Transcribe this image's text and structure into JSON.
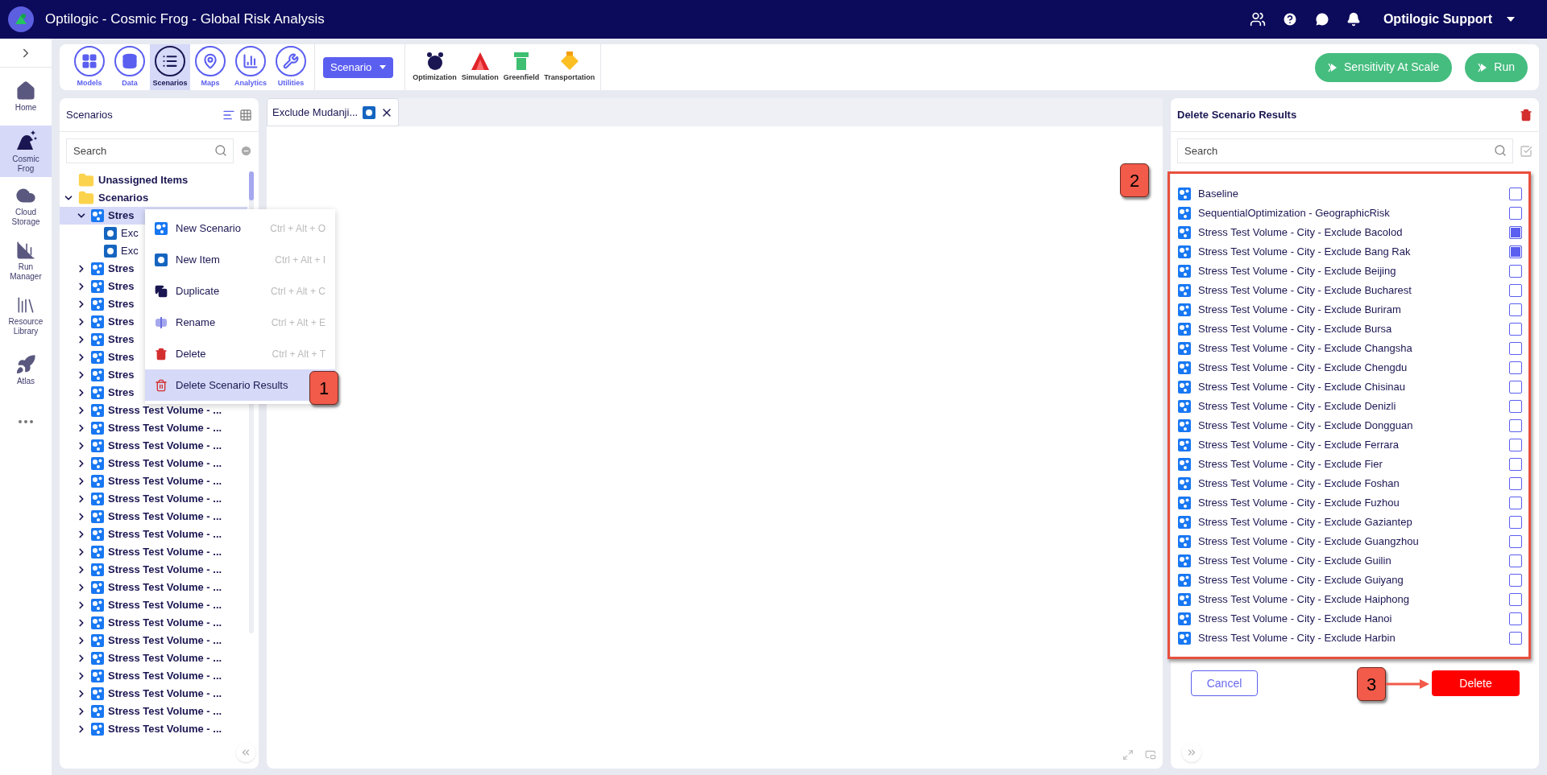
{
  "header": {
    "title": "Optilogic - Cosmic Frog - Global Risk Analysis",
    "user": "Optilogic Support"
  },
  "rail": {
    "items": [
      {
        "label": "Home",
        "selected": false
      },
      {
        "label": "Cosmic Frog",
        "selected": true
      },
      {
        "label": "Cloud Storage",
        "selected": false
      },
      {
        "label": "Run Manager",
        "selected": false
      },
      {
        "label": "Resource Library",
        "selected": false
      },
      {
        "label": "Atlas",
        "selected": false
      }
    ]
  },
  "toolbar": {
    "modules": [
      {
        "label": "Models",
        "selected": false
      },
      {
        "label": "Data",
        "selected": false
      },
      {
        "label": "Scenarios",
        "selected": true
      },
      {
        "label": "Maps",
        "selected": false
      },
      {
        "label": "Analytics",
        "selected": false
      },
      {
        "label": "Utilities",
        "selected": false
      }
    ],
    "dropdown": "Scenario",
    "engines": [
      "Optimization",
      "Simulation",
      "Greenfield",
      "Transportation"
    ],
    "actions": [
      "Sensitivity At Scale",
      "Run"
    ]
  },
  "scenarios_panel": {
    "title": "Scenarios",
    "search": {
      "placeholder": "Search"
    },
    "tree": [
      {
        "label": "Unassigned Items",
        "kind": "folder",
        "selected": false
      },
      {
        "label": "Scenarios",
        "kind": "folder",
        "expanded": true,
        "selected": false,
        "children": [
          {
            "label": "Stres",
            "kind": "scenario",
            "expanded": true,
            "selected": true,
            "children": [
              {
                "label": "Exc",
                "kind": "item",
                "selected": false
              },
              {
                "label": "Exc",
                "kind": "item",
                "selected": false
              }
            ]
          },
          {
            "label": "Stres",
            "kind": "scenario",
            "expanded": false,
            "selected": false
          },
          {
            "label": "Stres",
            "kind": "scenario",
            "expanded": false,
            "selected": false
          },
          {
            "label": "Stres",
            "kind": "scenario",
            "expanded": false,
            "selected": false
          },
          {
            "label": "Stres",
            "kind": "scenario",
            "expanded": false,
            "selected": false
          },
          {
            "label": "Stres",
            "kind": "scenario",
            "expanded": false,
            "selected": false
          },
          {
            "label": "Stres",
            "kind": "scenario",
            "expanded": false,
            "selected": false
          },
          {
            "label": "Stres",
            "kind": "scenario",
            "expanded": false,
            "selected": false
          },
          {
            "label": "Stres",
            "kind": "scenario",
            "expanded": false,
            "selected": false
          },
          {
            "label": "Stress Test Volume - ...",
            "kind": "scenario",
            "expanded": false,
            "selected": false
          },
          {
            "label": "Stress Test Volume - ...",
            "kind": "scenario",
            "expanded": false,
            "selected": false
          },
          {
            "label": "Stress Test Volume - ...",
            "kind": "scenario",
            "expanded": false,
            "selected": false
          },
          {
            "label": "Stress Test Volume - ...",
            "kind": "scenario",
            "expanded": false,
            "selected": false
          },
          {
            "label": "Stress Test Volume - ...",
            "kind": "scenario",
            "expanded": false,
            "selected": false
          },
          {
            "label": "Stress Test Volume - ...",
            "kind": "scenario",
            "expanded": false,
            "selected": false
          },
          {
            "label": "Stress Test Volume - ...",
            "kind": "scenario",
            "expanded": false,
            "selected": false
          },
          {
            "label": "Stress Test Volume - ...",
            "kind": "scenario",
            "expanded": false,
            "selected": false
          },
          {
            "label": "Stress Test Volume - ...",
            "kind": "scenario",
            "expanded": false,
            "selected": false
          },
          {
            "label": "Stress Test Volume - ...",
            "kind": "scenario",
            "expanded": false,
            "selected": false
          },
          {
            "label": "Stress Test Volume - ...",
            "kind": "scenario",
            "expanded": false,
            "selected": false
          },
          {
            "label": "Stress Test Volume - ...",
            "kind": "scenario",
            "expanded": false,
            "selected": false
          },
          {
            "label": "Stress Test Volume - ...",
            "kind": "scenario",
            "expanded": false,
            "selected": false
          },
          {
            "label": "Stress Test Volume - ...",
            "kind": "scenario",
            "expanded": false,
            "selected": false
          },
          {
            "label": "Stress Test Volume - ...",
            "kind": "scenario",
            "expanded": false,
            "selected": false
          },
          {
            "label": "Stress Test Volume - ...",
            "kind": "scenario",
            "expanded": false,
            "selected": false
          },
          {
            "label": "Stress Test Volume - ...",
            "kind": "scenario",
            "expanded": false,
            "selected": false
          },
          {
            "label": "Stress Test Volume - ...",
            "kind": "scenario",
            "expanded": false,
            "selected": false
          },
          {
            "label": "Stress Test Volume - ...",
            "kind": "scenario",
            "expanded": false,
            "selected": false
          }
        ]
      }
    ]
  },
  "context_menu": {
    "items": [
      {
        "label": "New Scenario",
        "shortcut": "Ctrl + Alt + O",
        "kind": "scenario",
        "selected": false
      },
      {
        "label": "New Item",
        "shortcut": "Ctrl + Alt + I",
        "kind": "item",
        "selected": false
      },
      {
        "label": "Duplicate",
        "shortcut": "Ctrl + Alt + C",
        "kind": "duplicate",
        "selected": false
      },
      {
        "label": "Rename",
        "shortcut": "Ctrl + Alt + E",
        "kind": "rename",
        "selected": false
      },
      {
        "label": "Delete",
        "shortcut": "Ctrl + Alt + T",
        "kind": "delete",
        "selected": false
      },
      {
        "label": "Delete Scenario Results",
        "kind": "delete-results",
        "selected": true
      }
    ]
  },
  "editor": {
    "tab": {
      "label": "Exclude Mudanji..."
    }
  },
  "results_panel": {
    "title": "Delete Scenario Results",
    "search": {
      "placeholder": "Search"
    },
    "items": [
      {
        "label": "Baseline",
        "checked": false
      },
      {
        "label": "SequentialOptimization - GeographicRisk",
        "checked": false
      },
      {
        "label": "Stress Test Volume - City - Exclude Bacolod",
        "checked": true
      },
      {
        "label": "Stress Test Volume - City - Exclude Bang Rak",
        "checked": true
      },
      {
        "label": "Stress Test Volume - City - Exclude Beijing",
        "checked": false
      },
      {
        "label": "Stress Test Volume - City - Exclude Bucharest",
        "checked": false
      },
      {
        "label": "Stress Test Volume - City - Exclude Buriram",
        "checked": false
      },
      {
        "label": "Stress Test Volume - City - Exclude Bursa",
        "checked": false
      },
      {
        "label": "Stress Test Volume - City - Exclude Changsha",
        "checked": false
      },
      {
        "label": "Stress Test Volume - City - Exclude Chengdu",
        "checked": false
      },
      {
        "label": "Stress Test Volume - City - Exclude Chisinau",
        "checked": false
      },
      {
        "label": "Stress Test Volume - City - Exclude Denizli",
        "checked": false
      },
      {
        "label": "Stress Test Volume - City - Exclude Dongguan",
        "checked": false
      },
      {
        "label": "Stress Test Volume - City - Exclude Ferrara",
        "checked": false
      },
      {
        "label": "Stress Test Volume - City - Exclude Fier",
        "checked": false
      },
      {
        "label": "Stress Test Volume - City - Exclude Foshan",
        "checked": false
      },
      {
        "label": "Stress Test Volume - City - Exclude Fuzhou",
        "checked": false
      },
      {
        "label": "Stress Test Volume - City - Exclude Gaziantep",
        "checked": false
      },
      {
        "label": "Stress Test Volume - City - Exclude Guangzhou",
        "checked": false
      },
      {
        "label": "Stress Test Volume - City - Exclude Guilin",
        "checked": false
      },
      {
        "label": "Stress Test Volume - City - Exclude Guiyang",
        "checked": false
      },
      {
        "label": "Stress Test Volume - City - Exclude Haiphong",
        "checked": false
      },
      {
        "label": "Stress Test Volume - City - Exclude Hanoi",
        "checked": false
      },
      {
        "label": "Stress Test Volume - City - Exclude Harbin",
        "checked": false
      }
    ],
    "buttons": {
      "cancel": "Cancel",
      "delete": "Delete"
    }
  },
  "callouts": [
    "1",
    "2",
    "3"
  ]
}
